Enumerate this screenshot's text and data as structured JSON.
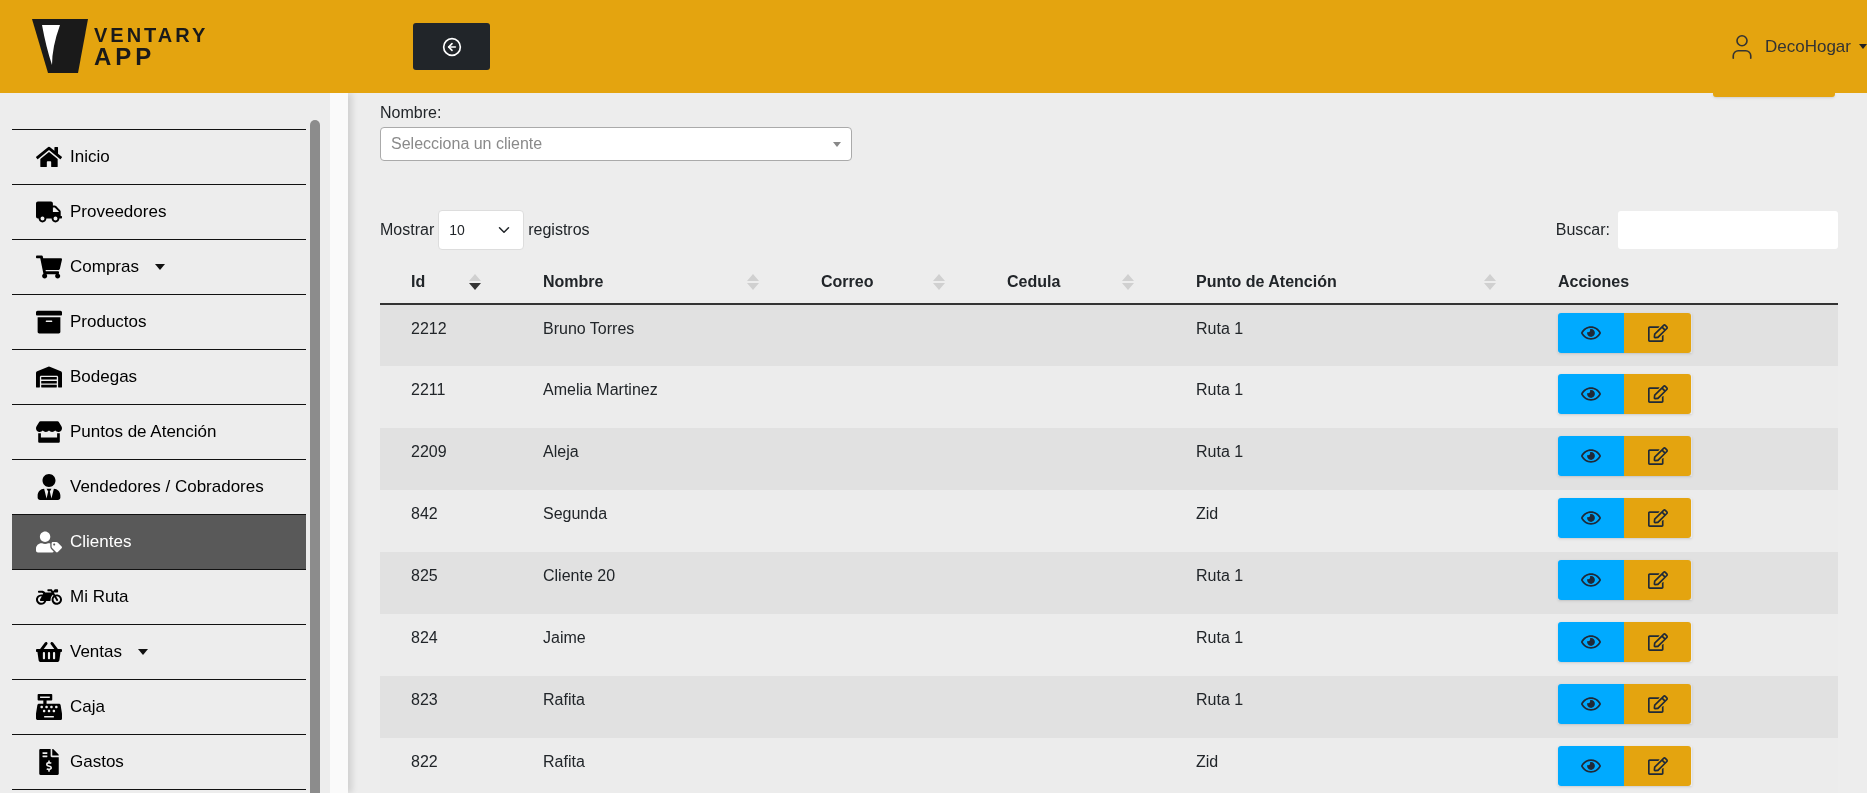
{
  "header": {
    "logo_top": "VENTARY",
    "logo_bottom": "APP",
    "user": "DecoHogar"
  },
  "sidebar": {
    "items": [
      {
        "label": "Inicio",
        "has_submenu": false,
        "selected": false
      },
      {
        "label": "Proveedores",
        "has_submenu": false,
        "selected": false
      },
      {
        "label": "Compras",
        "has_submenu": true,
        "selected": false
      },
      {
        "label": "Productos",
        "has_submenu": false,
        "selected": false
      },
      {
        "label": "Bodegas",
        "has_submenu": false,
        "selected": false
      },
      {
        "label": "Puntos de Atención",
        "has_submenu": false,
        "selected": false
      },
      {
        "label": "Vendedores / Cobradores",
        "has_submenu": false,
        "selected": false
      },
      {
        "label": "Clientes",
        "has_submenu": false,
        "selected": true
      },
      {
        "label": "Mi Ruta",
        "has_submenu": false,
        "selected": false
      },
      {
        "label": "Ventas",
        "has_submenu": true,
        "selected": false
      },
      {
        "label": "Caja",
        "has_submenu": false,
        "selected": false
      },
      {
        "label": "Gastos",
        "has_submenu": false,
        "selected": false
      }
    ]
  },
  "filter": {
    "label": "Nombre:",
    "placeholder": "Selecciona un cliente"
  },
  "table_controls": {
    "show_before": "Mostrar",
    "page_size": "10",
    "show_after": "registros",
    "search_label": "Buscar:"
  },
  "table": {
    "columns": [
      {
        "label": "Id",
        "sortable": true,
        "sorted": true
      },
      {
        "label": "Nombre",
        "sortable": true,
        "sorted": false
      },
      {
        "label": "Correo",
        "sortable": true,
        "sorted": false
      },
      {
        "label": "Cedula",
        "sortable": true,
        "sorted": false
      },
      {
        "label": "Punto de Atención",
        "sortable": true,
        "sorted": false
      },
      {
        "label": "Acciones",
        "sortable": false
      }
    ],
    "rows": [
      {
        "id": "2212",
        "nombre": "Bruno Torres",
        "punto": "Ruta 1"
      },
      {
        "id": "2211",
        "nombre": "Amelia Martinez",
        "punto": "Ruta 1"
      },
      {
        "id": "2209",
        "nombre": "Aleja",
        "punto": "Ruta 1"
      },
      {
        "id": "842",
        "nombre": "Segunda",
        "punto": "Zid"
      },
      {
        "id": "825",
        "nombre": "Cliente 20",
        "punto": "Ruta 1"
      },
      {
        "id": "824",
        "nombre": "Jaime",
        "punto": "Ruta 1"
      },
      {
        "id": "823",
        "nombre": "Rafita",
        "punto": "Ruta 1"
      },
      {
        "id": "822",
        "nombre": "Rafita",
        "punto": "Zid"
      }
    ]
  }
}
